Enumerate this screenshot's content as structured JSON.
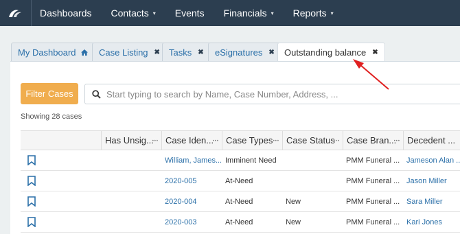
{
  "nav": {
    "items": [
      {
        "label": "Dashboards",
        "has_caret": false
      },
      {
        "label": "Contacts",
        "has_caret": true
      },
      {
        "label": "Events",
        "has_caret": false
      },
      {
        "label": "Financials",
        "has_caret": true
      },
      {
        "label": "Reports",
        "has_caret": true
      }
    ],
    "caret": "▾"
  },
  "tabs": [
    {
      "label": "My Dashboard",
      "icon": "home-icon"
    },
    {
      "label": "Case Listing",
      "icon": "close-icon"
    },
    {
      "label": "Tasks",
      "icon": "close-icon"
    },
    {
      "label": "eSignatures",
      "icon": "close-icon"
    },
    {
      "label": "Outstanding balance",
      "icon": "close-icon",
      "active": true
    }
  ],
  "toolbar": {
    "filter_label": "Filter Cases",
    "search_placeholder": "Start typing to search by Name, Case Number, Address, ..."
  },
  "showing_text": "Showing 28 cases",
  "table": {
    "columns": [
      "",
      "Has Unsig...",
      "Case Iden...",
      "Case Types",
      "Case Status",
      "Case Bran...",
      "Decedent ..."
    ],
    "rows": [
      {
        "case_id": "William, James...",
        "case_type": "Imminent Need",
        "status": "",
        "branch": "PMM Funeral ...",
        "decedent": "Jameson Alan ..."
      },
      {
        "case_id": "2020-005",
        "case_type": "At-Need",
        "status": "",
        "branch": "PMM Funeral ...",
        "decedent": "Jason Miller"
      },
      {
        "case_id": "2020-004",
        "case_type": "At-Need",
        "status": "New",
        "branch": "PMM Funeral ...",
        "decedent": "Sara Miller"
      },
      {
        "case_id": "2020-003",
        "case_type": "At-Need",
        "status": "New",
        "branch": "PMM Funeral ...",
        "decedent": "Kari Jones"
      }
    ]
  },
  "colors": {
    "nav_bg": "#2c3e50",
    "filter_btn": "#f0ad4e",
    "link": "#2a6fa8",
    "annotation_arrow": "#e02020"
  }
}
